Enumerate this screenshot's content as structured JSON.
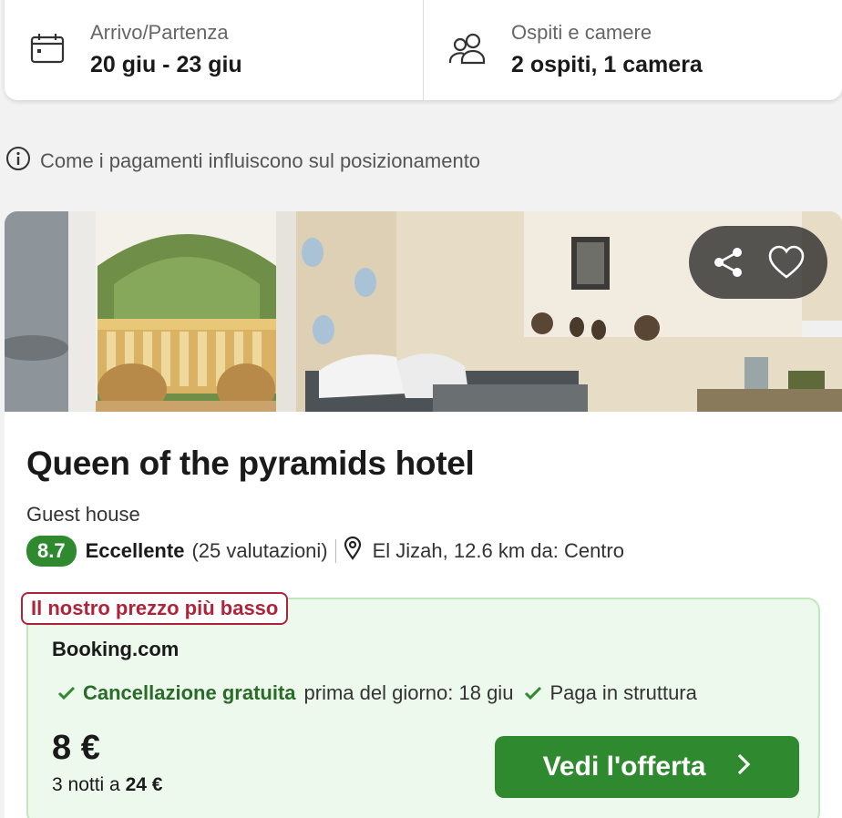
{
  "search": {
    "dates_label": "Arrivo/Partenza",
    "dates_value": "20 giu - 23 giu",
    "guests_label": "Ospiti e camere",
    "guests_value": "2 ospiti, 1 camera"
  },
  "info_line": "Come i pagamenti influiscono sul posizionamento",
  "hotel": {
    "name": "Queen of the pyramids hotel",
    "type": "Guest house",
    "rating": "8.7",
    "rating_word": "Eccellente",
    "rating_count": "(25 valutazioni)",
    "location": "El Jizah, 12.6 km da: Centro"
  },
  "offer": {
    "tag": "Il nostro prezzo più basso",
    "provider": "Booking.com",
    "free_cancel": "Cancellazione gratuita",
    "cancel_detail": "prima del giorno: 18 giu",
    "pay_at_property": "Paga in struttura",
    "price": "8 €",
    "total_prefix": "3 notti a ",
    "total_value": "24 €",
    "cta_label": "Vedi l'offerta"
  },
  "colors": {
    "accent_green": "#2f8a2f",
    "tag_red": "#b0243a",
    "offer_bg": "#edf9ec"
  },
  "icons": [
    "calendar-icon",
    "guests-icon",
    "info-icon",
    "share-icon",
    "heart-icon",
    "location-pin-icon",
    "check-icon",
    "chevron-right-icon"
  ]
}
